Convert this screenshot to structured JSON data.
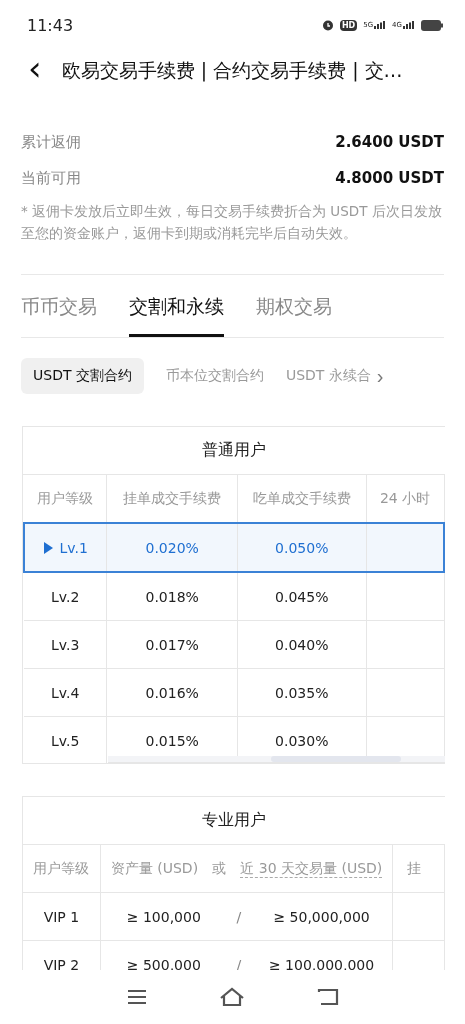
{
  "status_bar": {
    "time": "11:43",
    "hd": "HD",
    "network_1": "5G",
    "network_2": "4G"
  },
  "header": {
    "back": "‹",
    "title": "欧易交易手续费 | 合约交易手续费 | 交…"
  },
  "rebate": [
    {
      "label": "累计返佣",
      "value": "2.6400 USDT"
    },
    {
      "label": "当前可用",
      "value": "4.8000 USDT"
    }
  ],
  "note": "* 返佣卡发放后立即生效，每日交易手续费折合为 USDT 后次日发放至您的资金账户，返佣卡到期或消耗完毕后自动失效。",
  "tabs": [
    {
      "label": "币币交易",
      "selected": false
    },
    {
      "label": "交割和永续",
      "selected": true
    },
    {
      "label": "期权交易",
      "selected": false
    }
  ],
  "chips": [
    {
      "label": "USDT 交割合约",
      "selected": true
    },
    {
      "label": "币本位交割合约",
      "selected": false
    },
    {
      "label": "USDT 永续合",
      "selected": false
    }
  ],
  "chips_more": "›",
  "regular_table": {
    "title": "普通用户",
    "columns": [
      "用户等级",
      "挂单成交手续费",
      "吃单成交手续费",
      "24 小时"
    ],
    "rows": [
      {
        "level": "Lv.1",
        "maker": "0.020%",
        "taker": "0.050%",
        "selected": true
      },
      {
        "level": "Lv.2",
        "maker": "0.018%",
        "taker": "0.045%",
        "selected": false
      },
      {
        "level": "Lv.3",
        "maker": "0.017%",
        "taker": "0.040%",
        "selected": false
      },
      {
        "level": "Lv.4",
        "maker": "0.016%",
        "taker": "0.035%",
        "selected": false
      },
      {
        "level": "Lv.5",
        "maker": "0.015%",
        "taker": "0.030%",
        "selected": false
      }
    ]
  },
  "pro_table": {
    "title": "专业用户",
    "columns": [
      "用户等级",
      "资产量 (USD)",
      "或",
      "近 30 天交易量 (USD)",
      "挂"
    ],
    "rows": [
      {
        "level": "VIP 1",
        "assets": "≥ 100,000",
        "separator": "/",
        "volume": "≥ 50,000,000"
      },
      {
        "level": "VIP 2",
        "assets": "≥ 500,000",
        "separator": "/",
        "volume": "≥ 100,000,000"
      }
    ]
  }
}
